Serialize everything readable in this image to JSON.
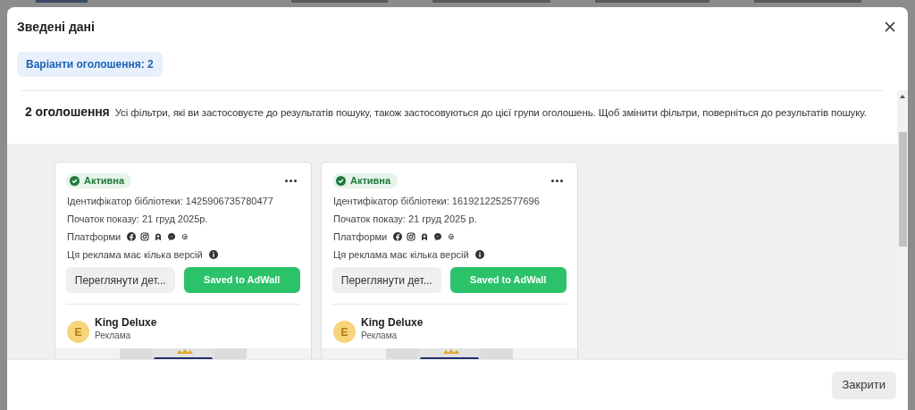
{
  "dialog": {
    "title": "Зведені дані"
  },
  "tabs": [
    {
      "label": "Варіанти оголошення: 2",
      "selected": true
    }
  ],
  "summary": {
    "count": "2 оголошення",
    "text": "Усі фільтри, які ви застосовуєте до результатів пошуку, також застосовуються до цієї групи оголошень. Щоб змінити фільтри, поверніться до результатів пошуку."
  },
  "ads": [
    {
      "status": "Активна",
      "active": true,
      "library_id": "Ідентифікатор бібліотеки: 1425906735780477",
      "start": "Початок показу: 21 груд 2025р.",
      "platforms_label": "Платформи",
      "versions_note": "Ця реклама має кілька версій",
      "details_button": "Переглянути дет...",
      "save_button": "Saved to AdWall",
      "advertiser": {
        "initial": "E",
        "name": "King Deluxe",
        "label": "Реклама"
      }
    },
    {
      "status": "Активна",
      "active": true,
      "library_id": "Ідентифікатор бібліотеки: 1619212252577696",
      "start": "Початок показу: 21 груд 2025 р.",
      "platforms_label": "Платформи",
      "versions_note": "Ця реклама має кілька версій",
      "details_button": "Переглянути дет...",
      "save_button": "Saved to AdWall",
      "advertiser": {
        "initial": "E",
        "name": "King Deluxe",
        "label": "Реклама"
      }
    }
  ],
  "footer": {
    "close_button": "Закрити"
  }
}
